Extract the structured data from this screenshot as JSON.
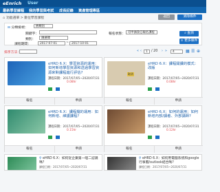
{
  "header": {
    "logo": "eEnrich",
    "logo_suffix": "User"
  },
  "menu": [
    "最新學習課程",
    "我的學習與考試",
    "成長記錄",
    "資產管理專區"
  ],
  "breadcrumb": "功能選單 > 數位學習課程",
  "actions": {
    "back": "返回",
    "clear": "清除條件"
  },
  "filter": {
    "mode_label": "分類檢視：",
    "mode_value": "依類別",
    "keyword_label": "關鍵字：",
    "keyword_value": "",
    "category_label": "類別：",
    "category_value": "請選擇",
    "status_label": "報名狀態：",
    "status_value": "可申請及已報名課程",
    "period_label": "課程期間：",
    "period_start": "2017-07-01",
    "period_sep": "~",
    "period_end": "2017-10-01",
    "search_button": "查詢",
    "more_button": "更多條件"
  },
  "sort": {
    "label": "排序方法：",
    "value": "",
    "page": "1",
    "total_pages": "/ 20",
    "page_size": "4"
  },
  "courses": [
    {
      "title": "eHRD 6.X：學習資源的運用：如何新增學習資源和透過學習資源來對課程進行評估?",
      "period": "課程日期：2017/07/05~2020/07/31",
      "hours": "0.08hr",
      "left_action": "報名",
      "right_action": "申請"
    },
    {
      "title": "eHRD 6.X：課程開課的模式：改版",
      "period": "課程日期：2017/07/05~2020/07/31",
      "hours": "0.08hr",
      "left_action": "報名",
      "right_action": "申請",
      "tag": "取消"
    },
    {
      "title": "eHRD 6.X：課程檔的運用：如何新增、維護課程?",
      "period": "課程日期：2017/07/05~2020/07/31",
      "hours": "0.15hr",
      "left_action": "報名",
      "right_action": "申請"
    },
    {
      "title": "eHRD 6.X：如何的運用：如何新增內部/講者、外部講師?",
      "period": "課程日期：2017/07/05~2020/07/31",
      "hours": "0.12hr",
      "left_action": "報名",
      "right_action": "申請"
    }
  ],
  "small_courses": [
    {
      "title": "eHRD 6.X：如何從企業第一哩二認識嗎?",
      "period": "課程日期：2017/07/05~2020/07/31"
    },
    {
      "title": "eHRD 6.X：如何用電腦系統和google行事曆/outlook結合嗎?",
      "period": "課程日期：2017/07/05~2020/07/31"
    }
  ],
  "colors": {
    "topbar": "#0a4f8f",
    "menubar": "#1266b0",
    "accent": "#1b6fc4",
    "highlight": "#e0474c"
  }
}
